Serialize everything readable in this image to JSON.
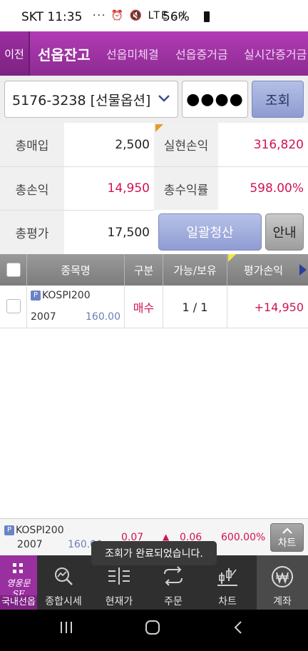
{
  "status_bar": {
    "carrier_time": "SKT 11:35",
    "icons": "··· ⏰ 🔇 LTE .ıl",
    "battery": "56%"
  },
  "tabs": {
    "back_label": "이전",
    "items": [
      "선옵잔고",
      "선옵미체결",
      "선옵증거금",
      "실시간증거금"
    ],
    "active_index": 0
  },
  "account": {
    "selected": "5176-3238 [선물옵션]",
    "password_masked": "●●●●",
    "query_label": "조회"
  },
  "summary": {
    "total_buy_label": "총매입",
    "total_buy_value": "2,500",
    "realized_pl_label": "실현손익",
    "realized_pl_value": "316,820",
    "total_pl_label": "총손익",
    "total_pl_value": "14,950",
    "total_return_label": "총수익률",
    "total_return_value": "598.00%",
    "total_eval_label": "총평가",
    "total_eval_value": "17,500",
    "bulk_clear_label": "일괄청산",
    "info_label": "안내"
  },
  "table": {
    "headers": [
      "종목명",
      "구분",
      "가능/보유",
      "평가손익"
    ],
    "rows": [
      {
        "badge": "P",
        "name": "KOSPI200",
        "expiry": "2007",
        "strike": "160.00",
        "side": "매수",
        "avail_hold": "1 / 1",
        "eval_pl": "+14,950"
      }
    ]
  },
  "quote_bar": {
    "badge": "P",
    "name": "KOSPI200",
    "expiry": "2007",
    "strike": "160.00",
    "price": "0.07",
    "change_arrow": "▲",
    "change": "0.06",
    "rate": "600.00%",
    "chart_label": "차트"
  },
  "toast": "조회가 완료되었습니다.",
  "bottom_nav": {
    "brand_label": "국내선옵",
    "brand_logo_text": "영웅문SF",
    "items": [
      {
        "label": "종합시세",
        "icon": "magnifier-chart-icon"
      },
      {
        "label": "현재가",
        "icon": "price-bars-icon"
      },
      {
        "label": "주문",
        "icon": "order-arrows-icon"
      },
      {
        "label": "차트",
        "icon": "chart-icon"
      },
      {
        "label": "계좌",
        "icon": "won-icon"
      }
    ],
    "active_index": 4
  },
  "colors": {
    "header_purple": "#9c2ea1",
    "profit_red": "#d0134f",
    "button_blue": "#8e9bd0"
  }
}
